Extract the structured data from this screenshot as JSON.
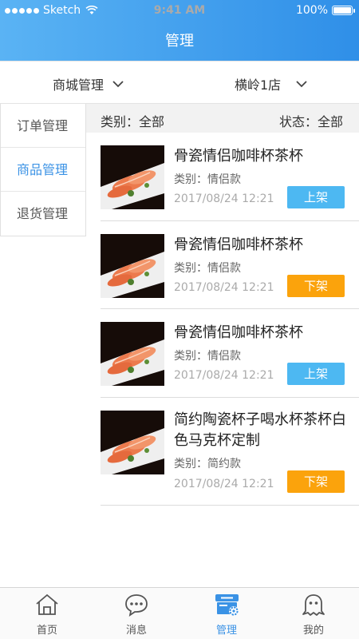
{
  "status_bar": {
    "carrier": "Sketch",
    "time": "9:41 AM",
    "battery": "100%"
  },
  "header": {
    "title": "管理"
  },
  "filters": [
    {
      "label": "商城管理"
    },
    {
      "label": "横岭1店"
    }
  ],
  "sidebar": {
    "items": [
      {
        "label": "订单管理"
      },
      {
        "label": "商品管理"
      },
      {
        "label": "退货管理"
      }
    ]
  },
  "category_bar": {
    "category": "类别：全部",
    "status": "状态：全部"
  },
  "products": [
    {
      "name": "骨瓷情侣咖啡杯茶杯",
      "category": "类别：情侣款",
      "time": "2017/08/24 12:21",
      "action": "上架"
    },
    {
      "name": "骨瓷情侣咖啡杯茶杯",
      "category": "类别：情侣款",
      "time": "2017/08/24 12:21",
      "action": "下架"
    },
    {
      "name": "骨瓷情侣咖啡杯茶杯",
      "category": "类别：情侣款",
      "time": "2017/08/24 12:21",
      "action": "上架"
    },
    {
      "name": "简约陶瓷杯子喝水杯茶杯白色马克杯定制",
      "category": "类别：简约款",
      "time": "2017/08/24 12:21",
      "action": "下架"
    }
  ],
  "tabbar": {
    "items": [
      {
        "label": "首页",
        "icon": "home-icon"
      },
      {
        "label": "消息",
        "icon": "message-icon"
      },
      {
        "label": "管理",
        "icon": "manage-icon"
      },
      {
        "label": "我的",
        "icon": "profile-icon"
      }
    ]
  },
  "colors": {
    "accent": "#3a92e5",
    "on_shelf": "#4db8f2",
    "off_shelf": "#fba30c"
  }
}
